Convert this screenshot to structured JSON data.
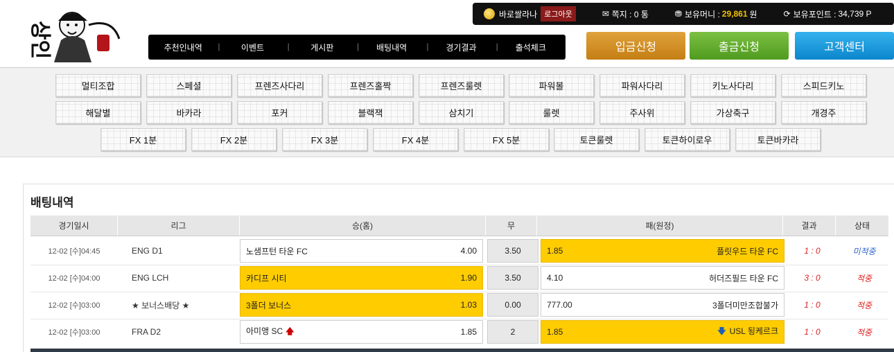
{
  "userbar": {
    "username": "바로쌀라나",
    "logout": "로그아웃",
    "messages_label": "쪽지 : 0 통",
    "money_label": "보유머니 :",
    "money_value": "29,861",
    "money_unit": "원",
    "points_label": "보유포인트 :",
    "points_value": "34,739 P"
  },
  "nav": [
    "추천인내역",
    "이벤트",
    "게시판",
    "배팅내역",
    "경기결과",
    "출석체크"
  ],
  "buttons": {
    "deposit": "입금신청",
    "withdraw": "출금신청",
    "support": "고객센터"
  },
  "games_row1": [
    "멀티조합",
    "스페셜",
    "프렌즈사다리",
    "프렌즈홀짝",
    "프렌즈룰렛",
    "파워볼",
    "파워사다리",
    "키노사다리",
    "스피드키노"
  ],
  "games_row2": [
    "해달별",
    "바카라",
    "포커",
    "블랙잭",
    "삼치기",
    "룰렛",
    "주사위",
    "가상축구",
    "개경주"
  ],
  "games_row3": [
    "FX 1분",
    "FX 2분",
    "FX 3분",
    "FX 4분",
    "FX 5분",
    "토큰룰렛",
    "토큰하이로우",
    "토큰바카라"
  ],
  "section_title": "배팅내역",
  "columns": [
    "경기일시",
    "리그",
    "승(홈)",
    "무",
    "패(원정)",
    "결과",
    "상태"
  ],
  "rows": [
    {
      "date": "12-02 [수]04:45",
      "league": "ENG D1",
      "home": "노샘프턴 타운 FC",
      "home_odds": "4.00",
      "draw": "3.50",
      "away_odds": "1.85",
      "away": "플릿우드 타운 FC",
      "result": "1 : 0",
      "status": "미적중"
    },
    {
      "date": "12-02 [수]04:00",
      "league": "ENG LCH",
      "home": "카디프 시티",
      "home_odds": "1.90",
      "draw": "3.50",
      "away_odds": "4.10",
      "away": "허더즈필드 타운 FC",
      "result": "3 : 0",
      "status": "적중"
    },
    {
      "date": "12-02 [수]03:00",
      "league": "★ 보너스배당 ★",
      "home": "3폴더 보너스",
      "home_odds": "1.03",
      "draw": "0.00",
      "away_odds": "777.00",
      "away": "3폴더미만조합불가",
      "result": "1 : 0",
      "status": "적중"
    },
    {
      "date": "12-02 [수]03:00",
      "league": "FRA D2",
      "home": "아미앵 SC",
      "home_odds": "1.85",
      "draw": "2",
      "away_odds": "1.85",
      "away": "USL 됭케르크",
      "result": "1 : 0",
      "status": "적중"
    }
  ]
}
